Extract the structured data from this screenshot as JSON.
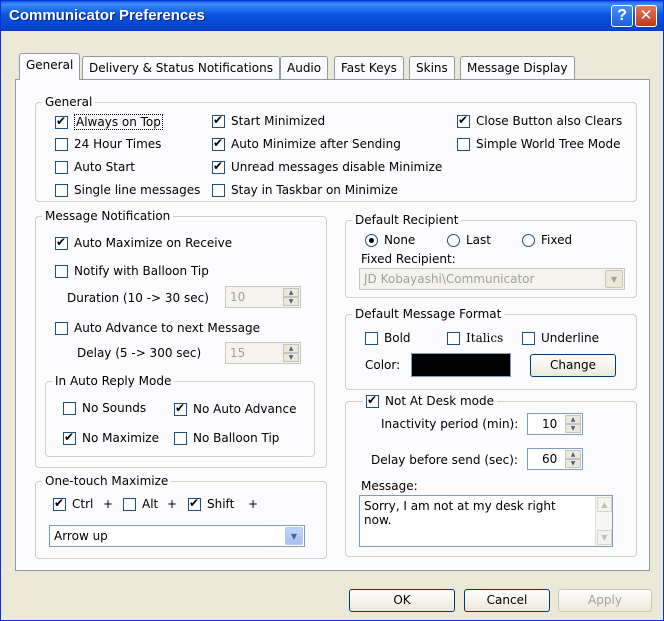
{
  "window": {
    "title": "Communicator Preferences",
    "help_icon": "?",
    "close_icon": "✕"
  },
  "tabs": [
    {
      "label": "General",
      "active": true
    },
    {
      "label": "Delivery & Status Notifications"
    },
    {
      "label": "Audio"
    },
    {
      "label": "Fast Keys"
    },
    {
      "label": "Skins"
    },
    {
      "label": "Message Display"
    }
  ],
  "general": {
    "title": "General",
    "options": [
      {
        "label": "Always on Top",
        "checked": true
      },
      {
        "label": "24 Hour Times",
        "checked": false
      },
      {
        "label": "Auto Start",
        "checked": false
      },
      {
        "label": "Single line messages",
        "checked": false
      },
      {
        "label": "Start Minimized",
        "checked": true
      },
      {
        "label": "Auto Minimize after Sending",
        "checked": true
      },
      {
        "label": "Unread messages disable Minimize",
        "checked": true
      },
      {
        "label": "Stay in Taskbar on Minimize",
        "checked": false
      },
      {
        "label": "Close Button also Clears",
        "checked": true
      },
      {
        "label": "Simple World Tree Mode",
        "checked": false
      }
    ]
  },
  "notification": {
    "title": "Message Notification",
    "auto_maximize": {
      "label": "Auto Maximize on Receive",
      "checked": true
    },
    "balloon": {
      "label": "Notify with Balloon Tip",
      "checked": false
    },
    "duration_label": "Duration (10 -> 30 sec)",
    "duration_value": "10",
    "auto_advance": {
      "label": "Auto Advance to next Message",
      "checked": false
    },
    "delay_label": "Delay (5 -> 300 sec)",
    "delay_value": "15",
    "auto_reply": {
      "title": "In Auto Reply Mode",
      "no_sounds": {
        "label": "No Sounds",
        "checked": false
      },
      "no_auto_advance": {
        "label": "No Auto Advance",
        "checked": true
      },
      "no_maximize": {
        "label": "No Maximize",
        "checked": true
      },
      "no_balloon": {
        "label": "No Balloon Tip",
        "checked": false
      }
    }
  },
  "one_touch": {
    "title": "One-touch Maximize",
    "ctrl": {
      "label": "Ctrl",
      "checked": true
    },
    "alt": {
      "label": "Alt",
      "checked": false
    },
    "shift": {
      "label": "Shift",
      "checked": true
    },
    "plus": "+",
    "key_value": "Arrow up"
  },
  "recipient": {
    "title": "Default Recipient",
    "none": {
      "label": "None",
      "selected": true
    },
    "last": {
      "label": "Last",
      "selected": false
    },
    "fixed": {
      "label": "Fixed",
      "selected": false
    },
    "fixed_label": "Fixed Recipient:",
    "fixed_value": "JD Kobayashi\\Communicator"
  },
  "format": {
    "title": "Default Message Format",
    "bold": {
      "label": "Bold",
      "checked": false
    },
    "italics": {
      "label": "Italics",
      "checked": false
    },
    "underline": {
      "label": "Underline",
      "checked": false
    },
    "color_label": "Color:",
    "color_value": "#000000",
    "change_label": "Change"
  },
  "not_at_desk": {
    "title": "Not At Desk mode",
    "checked": true,
    "inactivity_label": "Inactivity period (min):",
    "inactivity_value": "10",
    "delay_label": "Delay before send (sec):",
    "delay_value": "60",
    "message_label": "Message:",
    "message_value": "Sorry, I am not at my desk right now."
  },
  "buttons": {
    "ok": "OK",
    "cancel": "Cancel",
    "apply": "Apply"
  }
}
